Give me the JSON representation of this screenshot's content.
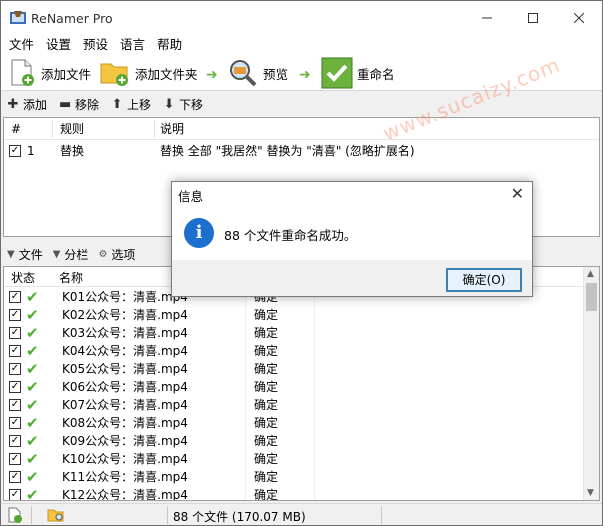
{
  "window": {
    "title": "ReNamer Pro"
  },
  "menu": [
    "文件",
    "设置",
    "预设",
    "语言",
    "帮助"
  ],
  "toolbar": {
    "add_files": "添加文件",
    "add_folder": "添加文件夹",
    "preview": "预览",
    "rename": "重命名"
  },
  "rules_actions": {
    "add": "添加",
    "remove": "移除",
    "up": "上移",
    "down": "下移"
  },
  "rules_table": {
    "headers": {
      "num": "#",
      "rule": "规则",
      "desc": "说明"
    },
    "rows": [
      {
        "checked": true,
        "num": "1",
        "rule": "替换",
        "desc": "替换 全部 \"我居然\" 替换为 \"清喜\" (忽略扩展名)"
      }
    ]
  },
  "files_actions": {
    "files": "文件",
    "columns": "分栏",
    "options": "选项"
  },
  "files_table": {
    "headers": {
      "status": "状态",
      "name": "名称"
    },
    "rows": [
      {
        "name": "K01公众号：清喜.mp4",
        "result": "确定"
      },
      {
        "name": "K02公众号：清喜.mp4",
        "result": "确定"
      },
      {
        "name": "K03公众号：清喜.mp4",
        "result": "确定"
      },
      {
        "name": "K04公众号：清喜.mp4",
        "result": "确定"
      },
      {
        "name": "K05公众号：清喜.mp4",
        "result": "确定"
      },
      {
        "name": "K06公众号：清喜.mp4",
        "result": "确定"
      },
      {
        "name": "K07公众号：清喜.mp4",
        "result": "确定"
      },
      {
        "name": "K08公众号：清喜.mp4",
        "result": "确定"
      },
      {
        "name": "K09公众号：清喜.mp4",
        "result": "确定"
      },
      {
        "name": "K10公众号：清喜.mp4",
        "result": "确定"
      },
      {
        "name": "K11公众号：清喜.mp4",
        "result": "确定"
      },
      {
        "name": "K12公众号：清喜.mp4",
        "result": "确定"
      }
    ]
  },
  "statusbar": {
    "summary": "88 个文件 (170.07 MB)"
  },
  "dialog": {
    "title": "信息",
    "message": "88 个文件重命名成功。",
    "ok_label": "确定(O)"
  },
  "watermark": "www.sucaizy.com",
  "colors": {
    "accent": "#1c6fcf",
    "check_green": "#4caf2f",
    "rename_green": "#6cb33e"
  }
}
